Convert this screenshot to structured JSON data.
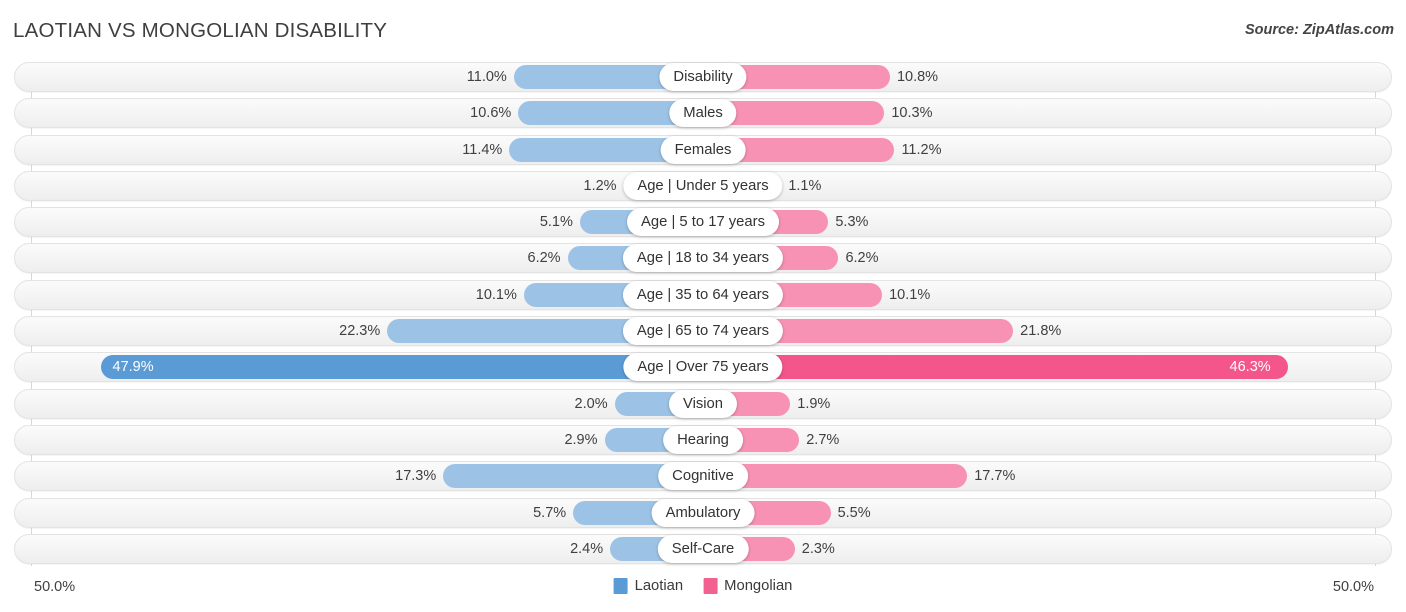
{
  "header": {
    "title": "LAOTIAN VS MONGOLIAN DISABILITY",
    "source": "Source: ZipAtlas.com"
  },
  "footer": {
    "axis_left": "50.0%",
    "axis_right": "50.0%",
    "legend": [
      {
        "label": "Laotian",
        "color": "#5b9bd5"
      },
      {
        "label": "Mongolian",
        "color": "#f2628f"
      }
    ]
  },
  "chart_data": {
    "type": "bar",
    "title": "LAOTIAN VS MONGOLIAN DISABILITY",
    "orientation": "horizontal-diverging",
    "xlabel": "",
    "ylabel": "",
    "xlim": [
      50.0,
      50.0
    ],
    "axis_max_percent": 50.0,
    "grid": true,
    "legend_position": "bottom-center",
    "series": [
      {
        "name": "Laotian",
        "color": "#9cc3e6",
        "highlight_color": "#5b9bd5",
        "values": [
          11.0,
          10.6,
          11.4,
          1.2,
          5.1,
          6.2,
          10.1,
          22.3,
          47.9,
          2.0,
          2.9,
          17.3,
          5.7,
          2.4
        ]
      },
      {
        "name": "Mongolian",
        "color": "#f792b4",
        "highlight_color": "#f4558a",
        "values": [
          10.8,
          10.3,
          11.2,
          1.1,
          5.3,
          6.2,
          10.1,
          21.8,
          46.3,
          1.9,
          2.7,
          17.7,
          5.5,
          2.3
        ]
      }
    ],
    "categories": [
      "Disability",
      "Males",
      "Females",
      "Age | Under 5 years",
      "Age | 5 to 17 years",
      "Age | 18 to 34 years",
      "Age | 35 to 64 years",
      "Age | 65 to 74 years",
      "Age | Over 75 years",
      "Vision",
      "Hearing",
      "Cognitive",
      "Ambulatory",
      "Self-Care"
    ]
  },
  "rows": [
    {
      "label": "Disability",
      "left_value": 11.0,
      "right_value": 10.8,
      "left_text": "11.0%",
      "right_text": "10.8%",
      "highlight": false
    },
    {
      "label": "Males",
      "left_value": 10.6,
      "right_value": 10.3,
      "left_text": "10.6%",
      "right_text": "10.3%",
      "highlight": false
    },
    {
      "label": "Females",
      "left_value": 11.4,
      "right_value": 11.2,
      "left_text": "11.4%",
      "right_text": "11.2%",
      "highlight": false
    },
    {
      "label": "Age | Under 5 years",
      "left_value": 1.2,
      "right_value": 1.1,
      "left_text": "1.2%",
      "right_text": "1.1%",
      "highlight": false
    },
    {
      "label": "Age | 5 to 17 years",
      "left_value": 5.1,
      "right_value": 5.3,
      "left_text": "5.1%",
      "right_text": "5.3%",
      "highlight": false
    },
    {
      "label": "Age | 18 to 34 years",
      "left_value": 6.2,
      "right_value": 6.2,
      "left_text": "6.2%",
      "right_text": "6.2%",
      "highlight": false
    },
    {
      "label": "Age | 35 to 64 years",
      "left_value": 10.1,
      "right_value": 10.1,
      "left_text": "10.1%",
      "right_text": "10.1%",
      "highlight": false
    },
    {
      "label": "Age | 65 to 74 years",
      "left_value": 22.3,
      "right_value": 21.8,
      "left_text": "22.3%",
      "right_text": "21.8%",
      "highlight": false
    },
    {
      "label": "Age | Over 75 years",
      "left_value": 47.9,
      "right_value": 46.3,
      "left_text": "47.9%",
      "right_text": "46.3%",
      "highlight": true
    },
    {
      "label": "Vision",
      "left_value": 2.0,
      "right_value": 1.9,
      "left_text": "2.0%",
      "right_text": "1.9%",
      "highlight": false
    },
    {
      "label": "Hearing",
      "left_value": 2.9,
      "right_value": 2.7,
      "left_text": "2.9%",
      "right_text": "2.7%",
      "highlight": false
    },
    {
      "label": "Cognitive",
      "left_value": 17.3,
      "right_value": 17.7,
      "left_text": "17.3%",
      "right_text": "17.7%",
      "highlight": false
    },
    {
      "label": "Ambulatory",
      "left_value": 5.7,
      "right_value": 5.5,
      "left_text": "5.7%",
      "right_text": "5.5%",
      "highlight": false
    },
    {
      "label": "Self-Care",
      "left_value": 2.4,
      "right_value": 2.3,
      "left_text": "2.4%",
      "right_text": "2.3%",
      "highlight": false
    }
  ]
}
